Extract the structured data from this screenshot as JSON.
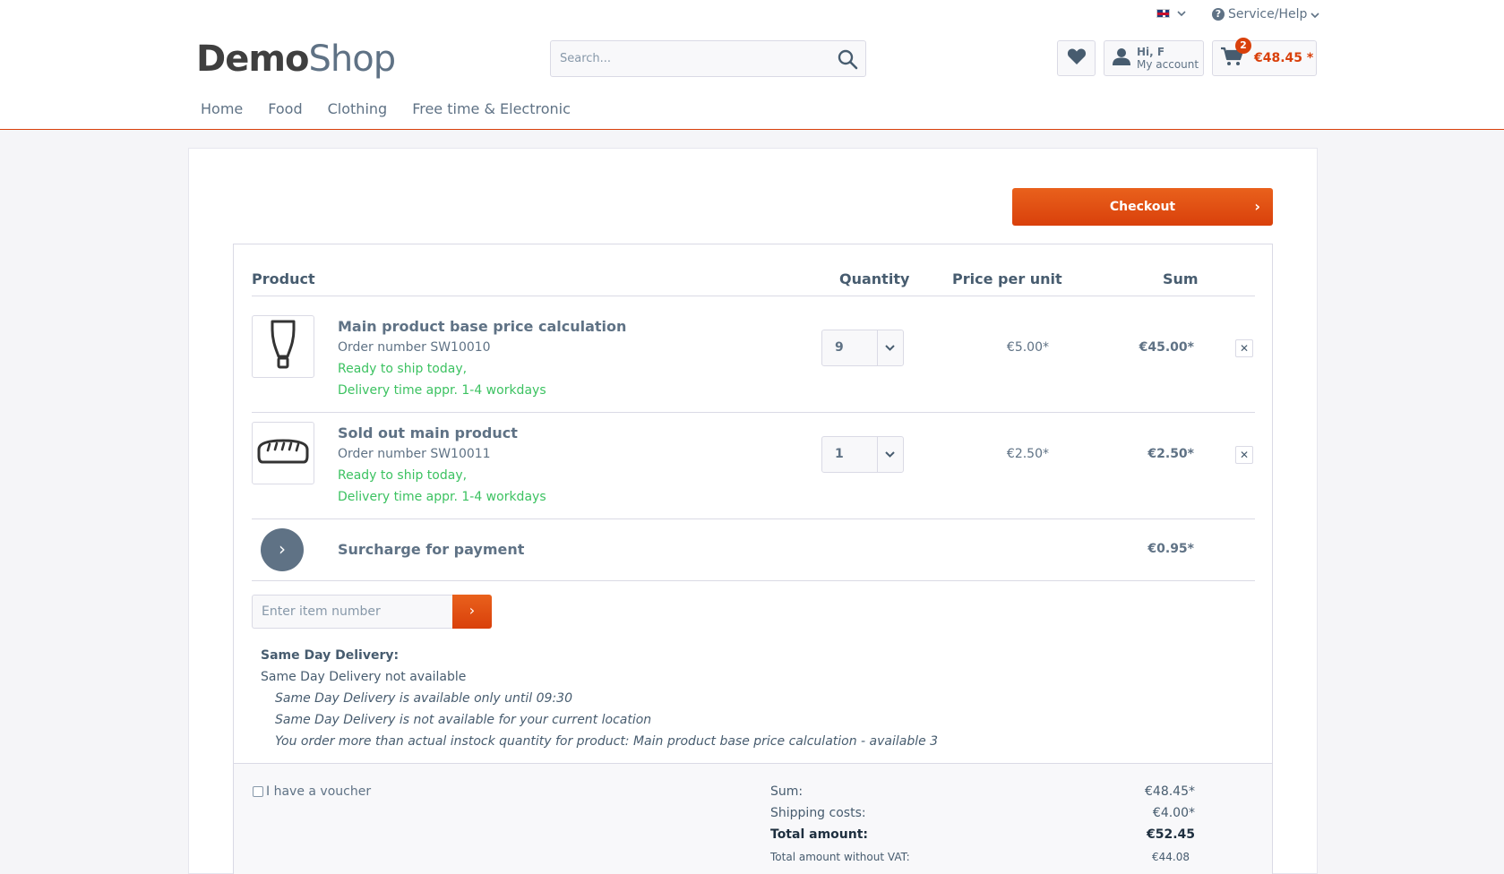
{
  "topbar": {
    "language_icon": "uk-flag-icon",
    "help_label": "Service/Help"
  },
  "logo": {
    "part1": "Demo",
    "part2": "Shop"
  },
  "search": {
    "placeholder": "Search..."
  },
  "account": {
    "greeting": "Hi, F",
    "label": "My account"
  },
  "cart": {
    "count": "2",
    "amount": "€48.45 *"
  },
  "nav": {
    "items": [
      "Home",
      "Food",
      "Clothing",
      "Free time & Electronic"
    ]
  },
  "checkout": {
    "label": "Checkout"
  },
  "table": {
    "headers": {
      "product": "Product",
      "quantity": "Quantity",
      "price_per_unit": "Price per unit",
      "sum": "Sum"
    },
    "rows": [
      {
        "name": "Main product base price calculation",
        "order_number": "Order number SW10010",
        "shipping_1": "Ready to ship today,",
        "shipping_2": "Delivery time appr. 1-4 workdays",
        "quantity": "9",
        "unit_price": "€5.00*",
        "sum": "€45.00*",
        "icon": "tube-icon"
      },
      {
        "name": "Sold out main product",
        "order_number": "Order number SW10011",
        "shipping_1": "Ready to ship today,",
        "shipping_2": "Delivery time appr. 1-4 workdays",
        "quantity": "1",
        "unit_price": "€2.50*",
        "sum": "€2.50*",
        "icon": "bread-icon"
      }
    ],
    "surcharge": {
      "label": "Surcharge for payment",
      "sum": "€0.95*"
    }
  },
  "add_item": {
    "placeholder": "Enter item number"
  },
  "same_day": {
    "title": "Same Day Delivery:",
    "status": "Same Day Delivery not available",
    "notes": [
      "Same Day Delivery is available only until 09:30",
      "Same Day Delivery is not available for your current location",
      "You order more than actual instock quantity for product: Main product base price calculation - available 3"
    ]
  },
  "voucher": {
    "label": "I have a voucher"
  },
  "totals": {
    "sum_label": "Sum:",
    "sum_value": "€48.45*",
    "shipping_label": "Shipping costs:",
    "shipping_value": "€4.00*",
    "total_label": "Total amount:",
    "total_value": "€52.45",
    "net_label": "Total amount without VAT:",
    "net_value": "€44.08"
  },
  "colors": {
    "accent": "#d9400b",
    "text": "#5f7285",
    "success": "#3cc261"
  }
}
